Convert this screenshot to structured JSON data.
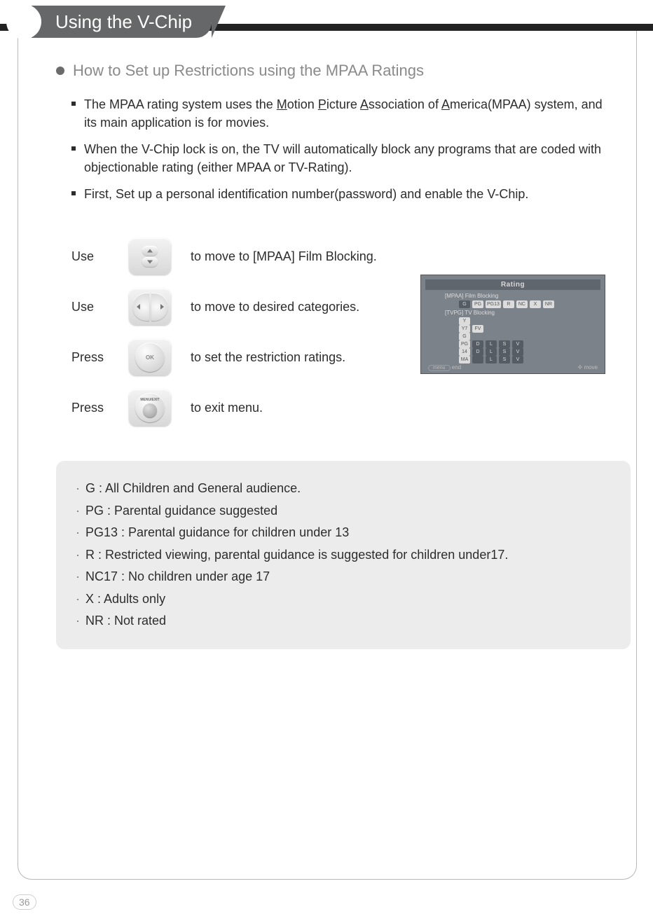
{
  "page": {
    "number": "36",
    "title": "Using the V-Chip",
    "section_heading": "How to Set up Restrictions using the MPAA Ratings"
  },
  "intro": [
    {
      "prefix": "The MPAA rating system uses the ",
      "u1": "M",
      "t1": "otion ",
      "u2": "P",
      "t2": "icture ",
      "u3": "A",
      "t3": "ssociation of ",
      "u4": "A",
      "t4": "merica(MPAA) system, and its main application is for movies."
    },
    {
      "plain": "When the V-Chip lock is on, the TV will automatically block any programs that are coded with objectionable rating (either MPAA or TV-Rating)."
    },
    {
      "plain": "First, Set up a personal identification number(password) and enable the V-Chip."
    }
  ],
  "steps": [
    {
      "verb": "Use",
      "icon": "nav-up-down",
      "desc": "to move to [MPAA] Film Blocking."
    },
    {
      "verb": "Use",
      "icon": "nav-left-right",
      "desc": "to move to desired categories."
    },
    {
      "verb": "Press",
      "icon": "ok-button",
      "desc": "to set the restriction ratings."
    },
    {
      "verb": "Press",
      "icon": "menu-exit-button",
      "desc": "to exit menu."
    }
  ],
  "thumb": {
    "title": "Rating",
    "row1": "[MPAA] Film Blocking",
    "row1_chips": [
      "G",
      "PG",
      "PG13",
      "R",
      "NC",
      "X",
      "NR"
    ],
    "row2": "[TVPG] TV Blocking",
    "grid": [
      [
        "Y"
      ],
      [
        "Y7",
        "FV"
      ],
      [
        "G"
      ],
      [
        "PG",
        "D",
        "L",
        "S",
        "V"
      ],
      [
        "14",
        "D",
        "L",
        "S",
        "V"
      ],
      [
        "MA",
        "",
        "L",
        "S",
        "V"
      ]
    ],
    "foot_left_icon": "menu",
    "foot_left": "end",
    "foot_right": "move"
  },
  "ratings": [
    "G : All Children and General audience.",
    "PG : Parental guidance suggested",
    "PG13 : Parental guidance for children under 13",
    "R : Restricted viewing, parental guidance is suggested for children under17.",
    "NC17 : No children under age 17",
    "X : Adults only",
    "NR : Not rated"
  ]
}
